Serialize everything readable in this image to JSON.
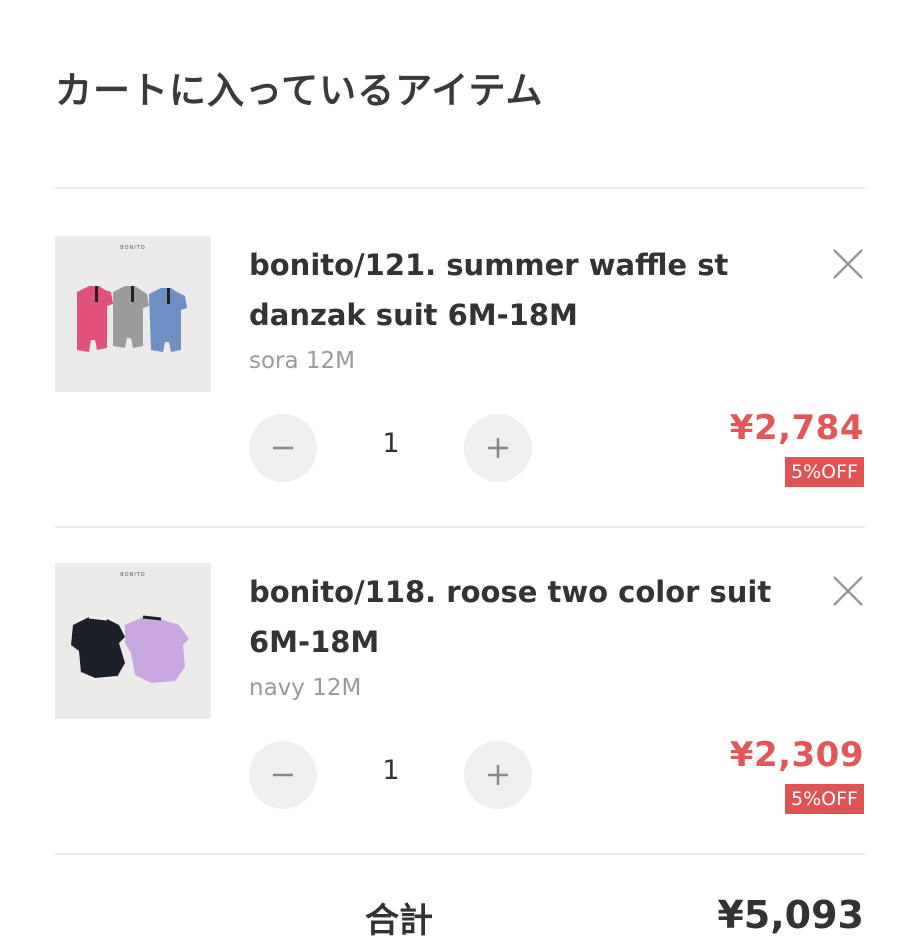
{
  "page": {
    "title": "カートに入っているアイテム"
  },
  "cart": {
    "items": [
      {
        "thumbnail_brand": "BONITO",
        "name": "bonito/121. summer waffle st danzak suit 6M-18M",
        "variant": "sora 12M",
        "quantity": "1",
        "price": "¥2,784",
        "discount": "5%OFF",
        "remove_icon": "close-icon",
        "minus_icon": "minus-icon",
        "plus_icon": "plus-icon"
      },
      {
        "thumbnail_brand": "BONITO",
        "name": "bonito/118. roose two color suit 6M-18M",
        "variant": "navy 12M",
        "quantity": "1",
        "price": "¥2,309",
        "discount": "5%OFF",
        "remove_icon": "close-icon",
        "minus_icon": "minus-icon",
        "plus_icon": "plus-icon"
      }
    ]
  },
  "summary": {
    "total_label": "合計",
    "total_value": "¥5,093"
  },
  "colors": {
    "price": "#e25757",
    "badge": "#e05353",
    "qty_button": "#efefef",
    "divider": "#e9e9e9"
  }
}
